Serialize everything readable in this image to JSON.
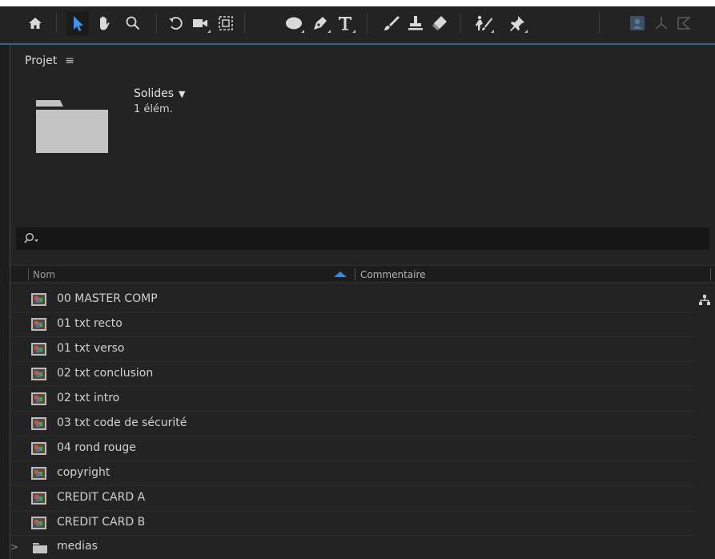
{
  "project": {
    "tab_label": "Projet",
    "folder": {
      "name": "Solides",
      "count": "1 élém."
    },
    "columns": {
      "name": "Nom",
      "comment": "Commentaire"
    }
  },
  "items": [
    {
      "label": "00 MASTER COMP",
      "type": "comp"
    },
    {
      "label": "01 txt recto",
      "type": "comp"
    },
    {
      "label": "01 txt verso",
      "type": "comp"
    },
    {
      "label": "02 txt conclusion",
      "type": "comp"
    },
    {
      "label": "02 txt intro",
      "type": "comp"
    },
    {
      "label": "03 txt code de sécurité",
      "type": "comp"
    },
    {
      "label": "04 rond rouge",
      "type": "comp"
    },
    {
      "label": "copyright",
      "type": "comp"
    },
    {
      "label": "CREDIT CARD A",
      "type": "comp"
    },
    {
      "label": "CREDIT CARD B",
      "type": "comp"
    },
    {
      "label": "medias",
      "type": "folder"
    }
  ],
  "colors": {
    "accent": "#2f8be0",
    "panel": "#232323",
    "toolbar_border": "#3a5f80"
  },
  "toolbar_icons": [
    "home-icon",
    "selection-arrow-icon",
    "hand-icon",
    "zoom-icon",
    "rotate-icon",
    "camera-icon",
    "pan-behind-icon",
    "ellipse-icon",
    "pen-icon",
    "text-icon",
    "brush-icon",
    "clone-stamp-icon",
    "eraser-icon",
    "roto-brush-icon",
    "puppet-pin-icon",
    "user-icon",
    "3d-axis-icon",
    "shape-icon"
  ]
}
